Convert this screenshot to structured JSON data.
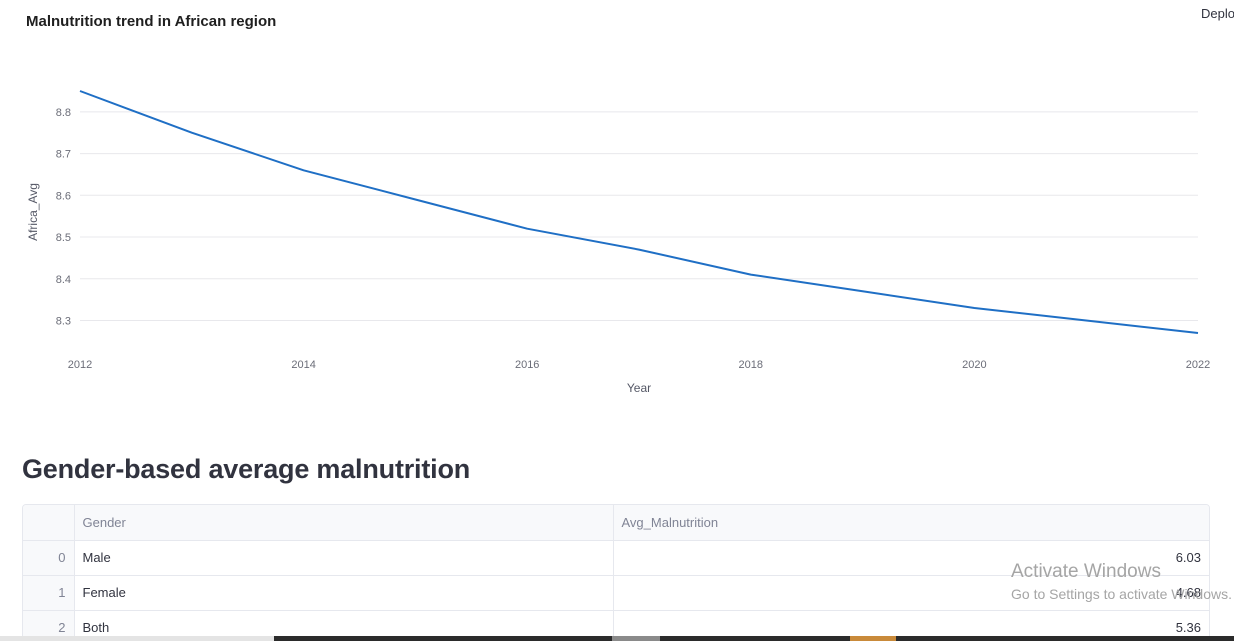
{
  "header": {
    "deploy_label": "Deplo"
  },
  "chart": {
    "title": "Malnutrition trend in African region"
  },
  "chart_data": {
    "type": "line",
    "title": "Malnutrition trend in African region",
    "xlabel": "Year",
    "ylabel": "Africa_Avg",
    "x": [
      2012,
      2013,
      2014,
      2015,
      2016,
      2017,
      2018,
      2019,
      2020,
      2021,
      2022
    ],
    "series": [
      {
        "values": [
          8.85,
          8.75,
          8.66,
          8.59,
          8.52,
          8.47,
          8.41,
          8.37,
          8.33,
          8.3,
          8.27
        ]
      }
    ],
    "xticks": [
      2012,
      2014,
      2016,
      2018,
      2020,
      2022
    ],
    "yticks": [
      8.3,
      8.4,
      8.5,
      8.6,
      8.7,
      8.8
    ],
    "xlim": [
      2012,
      2022
    ],
    "ylim": [
      8.27,
      8.85
    ],
    "grid": "horizontal",
    "line_color": "#1f6fc5"
  },
  "section": {
    "heading": "Gender-based average malnutrition"
  },
  "table": {
    "columns": [
      "",
      "Gender",
      "Avg_Malnutrition"
    ],
    "rows": [
      {
        "index": "0",
        "gender": "Male",
        "value": "6.03"
      },
      {
        "index": "1",
        "gender": "Female",
        "value": "4.68"
      },
      {
        "index": "2",
        "gender": "Both",
        "value": "5.36"
      }
    ]
  },
  "watermark": {
    "title": "Activate Windows",
    "subtitle": "Go to Settings to activate Windows."
  }
}
